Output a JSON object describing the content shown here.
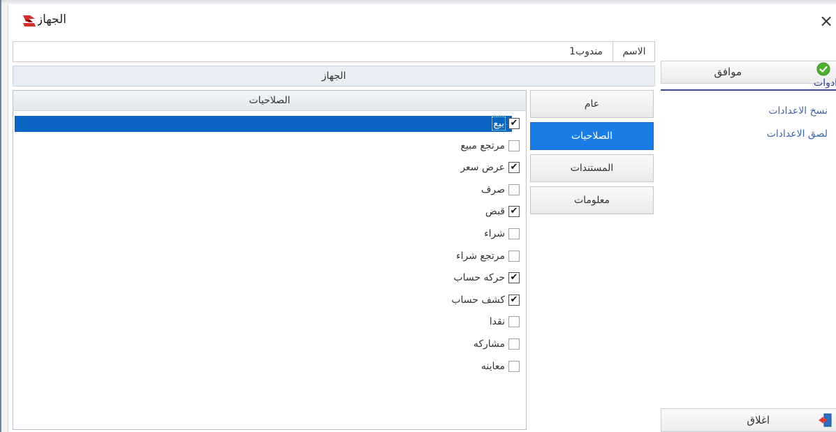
{
  "window": {
    "title": "الجهاز",
    "close_glyph": "×"
  },
  "name_row": {
    "label": "الاسم",
    "value": "مندوب1"
  },
  "device_header": "الجهاز",
  "permissions": {
    "header": "الصلاحيات",
    "items": [
      {
        "label": "بيع",
        "checked": true,
        "selected": true
      },
      {
        "label": "مرتجع مبيع",
        "checked": false,
        "selected": false
      },
      {
        "label": "عرض سعر",
        "checked": true,
        "selected": false
      },
      {
        "label": "صرف",
        "checked": false,
        "selected": false
      },
      {
        "label": "قبض",
        "checked": true,
        "selected": false
      },
      {
        "label": "شراء",
        "checked": false,
        "selected": false
      },
      {
        "label": "مرتجع شراء",
        "checked": false,
        "selected": false
      },
      {
        "label": "حركه حساب",
        "checked": true,
        "selected": false
      },
      {
        "label": "كشف حساب",
        "checked": true,
        "selected": false
      },
      {
        "label": "نقدا",
        "checked": false,
        "selected": false
      },
      {
        "label": "مشاركه",
        "checked": false,
        "selected": false
      },
      {
        "label": "معاينه",
        "checked": false,
        "selected": false
      }
    ]
  },
  "tabs": [
    {
      "label": "عام",
      "active": false
    },
    {
      "label": "الصلاحيات",
      "active": true
    },
    {
      "label": "المستندات",
      "active": false
    },
    {
      "label": "معلومات",
      "active": false
    }
  ],
  "side": {
    "ok_label": "موافق",
    "tools_title": "ادوات",
    "copy_settings": "نسخ الاعدادات",
    "paste_settings": "لصق الاعدادات",
    "close_label": "اغلاق"
  },
  "colors": {
    "accent": "#1a7de6",
    "selection": "#0a66c2",
    "ok_icon": "#4caf2f",
    "tools_underline": "#3d4a8a"
  },
  "icons": {
    "app_logo": "app-logo-icon",
    "ok": "check-circle-icon",
    "close": "exit-door-icon",
    "window_close": "close-icon"
  }
}
